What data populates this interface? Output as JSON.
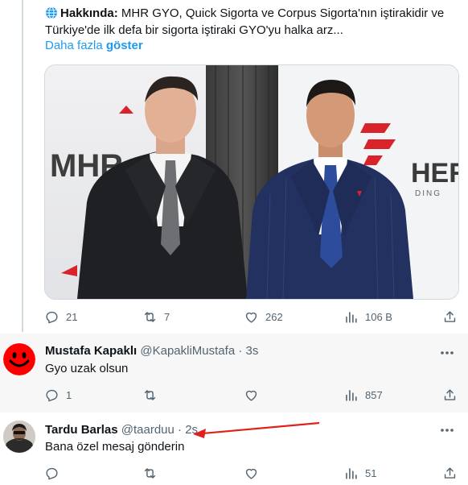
{
  "about": {
    "label": "Hakkında:",
    "text": "MHR GYO, Quick Sigorta ve Corpus Sigorta'nın iştirakidir ve Türkiye'de ilk defa bir sigorta iştiraki GYO'yu halka arz...",
    "more_prefix": "Daha fazla",
    "more_bold": "göster"
  },
  "post_actions": {
    "replies": "21",
    "reposts": "7",
    "likes": "262",
    "views": "106 B"
  },
  "photo": {
    "logo_left": "MHR",
    "logo_right": "HER",
    "logo_right_sub": "DING"
  },
  "replies": [
    {
      "name": "Mustafa Kapaklı",
      "handle": "@KapakliMustafa · 3s",
      "text": "Gyo uzak olsun",
      "replies": "1",
      "views": "857",
      "avatar_color": "#ff0000"
    },
    {
      "name": "Tardu Barlas",
      "handle": "@taarduu · 2s",
      "text": "Bana özel mesaj gönderin",
      "views": "51",
      "annotation_color": "#e0201a"
    }
  ],
  "colors": {
    "link": "#1d9bf0",
    "muted": "#536471",
    "thread_line": "#cfd9de"
  }
}
